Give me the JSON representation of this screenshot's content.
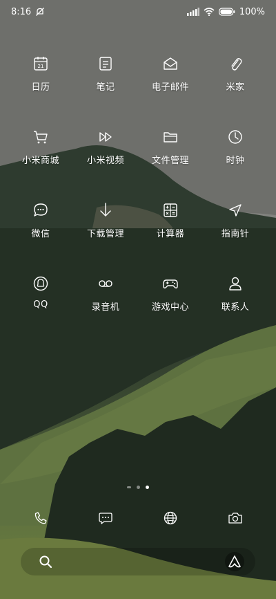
{
  "status": {
    "time": "8:16",
    "battery": "100%"
  },
  "apps": [
    {
      "label": "日历",
      "icon": "calendar-icon",
      "day": "21"
    },
    {
      "label": "笔记",
      "icon": "notes-icon"
    },
    {
      "label": "电子邮件",
      "icon": "email-icon"
    },
    {
      "label": "米家",
      "icon": "paperclip-icon"
    },
    {
      "label": "小米商城",
      "icon": "shopping-cart-icon"
    },
    {
      "label": "小米视频",
      "icon": "video-fast-forward-icon"
    },
    {
      "label": "文件管理",
      "icon": "folder-icon"
    },
    {
      "label": "时钟",
      "icon": "clock-icon"
    },
    {
      "label": "微信",
      "icon": "chat-bubble-icon"
    },
    {
      "label": "下载管理",
      "icon": "download-arrow-icon"
    },
    {
      "label": "计算器",
      "icon": "calculator-icon"
    },
    {
      "label": "指南针",
      "icon": "compass-icon"
    },
    {
      "label": "QQ",
      "icon": "qq-icon"
    },
    {
      "label": "录音机",
      "icon": "voicemail-icon"
    },
    {
      "label": "游戏中心",
      "icon": "gamepad-icon"
    },
    {
      "label": "联系人",
      "icon": "person-icon"
    }
  ],
  "page_indicator": {
    "pages": 3,
    "active_index": 2
  },
  "dock": [
    "phone-icon",
    "message-icon",
    "globe-icon",
    "camera-icon"
  ]
}
